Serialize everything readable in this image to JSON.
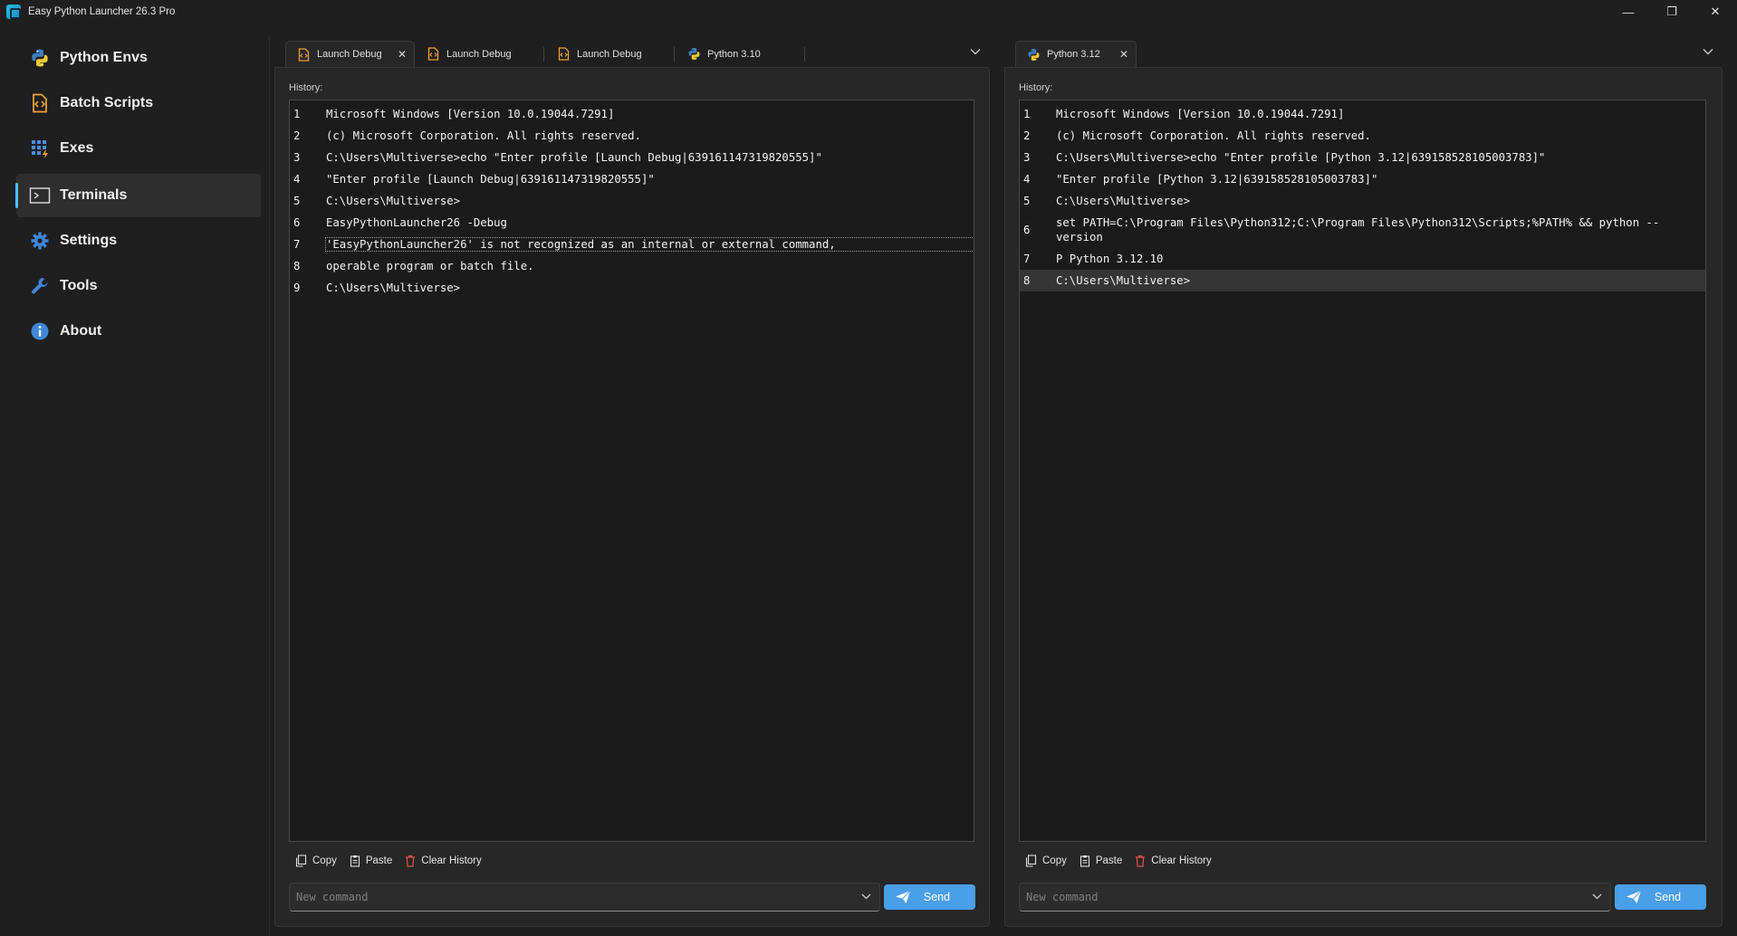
{
  "window": {
    "title": "Easy Python Launcher 26.3 Pro",
    "controls": {
      "minimize": "—",
      "restore": "❐",
      "close": "✕"
    }
  },
  "sidebar": {
    "items": [
      {
        "label": "Python Envs",
        "icon": "python-icon",
        "active": false
      },
      {
        "label": "Batch Scripts",
        "icon": "batch-script-icon",
        "active": false
      },
      {
        "label": "Exes",
        "icon": "exes-grid-icon",
        "active": false
      },
      {
        "label": "Terminals",
        "icon": "terminal-icon",
        "active": true
      },
      {
        "label": "Settings",
        "icon": "gear-icon",
        "active": false
      },
      {
        "label": "Tools",
        "icon": "wrench-icon",
        "active": false
      },
      {
        "label": "About",
        "icon": "info-icon",
        "active": false
      }
    ]
  },
  "left_panel": {
    "tabs": [
      {
        "label": "Launch Debug",
        "icon": "script-icon",
        "active": true,
        "close": "✕"
      },
      {
        "label": "Launch Debug",
        "icon": "script-icon",
        "active": false
      },
      {
        "label": "Launch Debug",
        "icon": "script-icon",
        "active": false
      },
      {
        "label": "Python 3.10",
        "icon": "python-icon",
        "active": false
      }
    ],
    "overflow_icon": "chevron-down-icon",
    "history_label": "History:",
    "lines": [
      {
        "n": "1",
        "t": "Microsoft Windows [Version 10.0.19044.7291]"
      },
      {
        "n": "2",
        "t": "(c) Microsoft Corporation. All rights reserved."
      },
      {
        "n": "3",
        "t": "C:\\Users\\Multiverse>echo \"Enter profile [Launch Debug|639161147319820555]\""
      },
      {
        "n": "4",
        "t": "\"Enter profile [Launch Debug|639161147319820555]\""
      },
      {
        "n": "5",
        "t": "C:\\Users\\Multiverse>"
      },
      {
        "n": "6",
        "t": "EasyPythonLauncher26 -Debug"
      },
      {
        "n": "7",
        "t": "'EasyPythonLauncher26' is not recognized as an internal or external command,"
      },
      {
        "n": "8",
        "t": "operable program or batch file."
      },
      {
        "n": "9",
        "t": "C:\\Users\\Multiverse>"
      }
    ],
    "actions": {
      "copy": "Copy",
      "paste": "Paste",
      "clear": "Clear History"
    },
    "command_placeholder": "New command",
    "send_label": "Send"
  },
  "right_panel": {
    "tabs": [
      {
        "label": "Python 3.12",
        "icon": "python-icon",
        "active": true,
        "close": "✕"
      }
    ],
    "overflow_icon": "chevron-down-icon",
    "history_label": "History:",
    "lines": [
      {
        "n": "1",
        "t": "Microsoft Windows [Version 10.0.19044.7291]"
      },
      {
        "n": "2",
        "t": "(c) Microsoft Corporation. All rights reserved."
      },
      {
        "n": "3",
        "t": "C:\\Users\\Multiverse>echo \"Enter profile [Python 3.12|639158528105003783]\""
      },
      {
        "n": "4",
        "t": "\"Enter profile [Python 3.12|639158528105003783]\""
      },
      {
        "n": "5",
        "t": "C:\\Users\\Multiverse>"
      },
      {
        "n": "6",
        "t": "set PATH=C:\\Program Files\\Python312;C:\\Program Files\\Python312\\Scripts;%PATH% && python --version"
      },
      {
        "n": "7",
        "t": "P Python 3.12.10"
      },
      {
        "n": "8",
        "t": "C:\\Users\\Multiverse>"
      }
    ],
    "actions": {
      "copy": "Copy",
      "paste": "Paste",
      "clear": "Clear History"
    },
    "command_placeholder": "New command",
    "send_label": "Send"
  },
  "colors": {
    "accent": "#4cc2ff",
    "send_button": "#4a9fe8",
    "background": "#1f1f1f",
    "console_bg": "#1b1b1b"
  }
}
